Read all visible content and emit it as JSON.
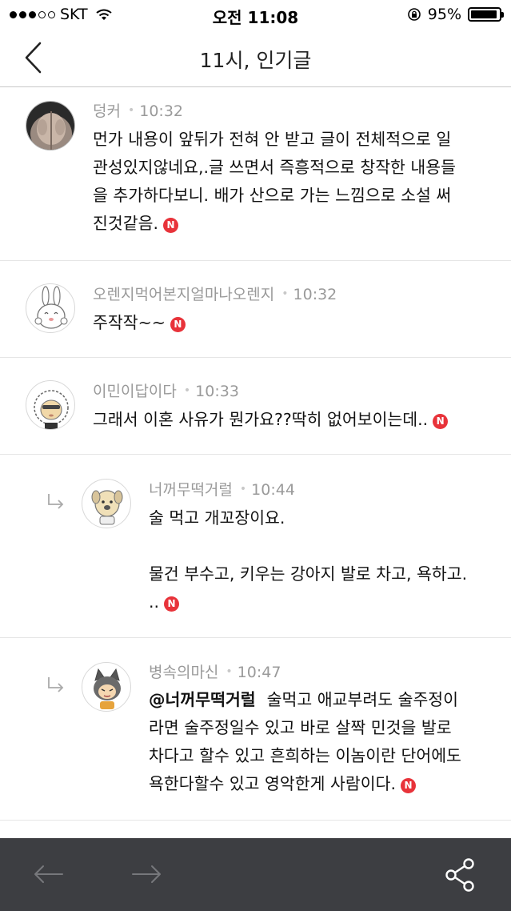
{
  "status": {
    "carrier": "SKT",
    "time": "오전 11:08",
    "battery_percent": "95%",
    "battery_level": 0.95
  },
  "nav": {
    "title": "11시, 인기글",
    "back_icon": "chevron-left-icon"
  },
  "comments": [
    {
      "author": "덩커",
      "time": "10:32",
      "text": "먼가 내용이 앞뒤가 전혀 안 받고 글이 전체적으로 일\n관성있지않네요,.글 쓰면서 즉흥적으로 창작한 내용들\n을 추가하다보니. 배가 산으로 가는 느낌으로 소설 써\n진것같음.",
      "badge": "N",
      "is_reply": false
    },
    {
      "author": "오렌지먹어본지얼마나오렌지",
      "time": "10:32",
      "text": "주작작~~",
      "badge": "N",
      "is_reply": false
    },
    {
      "author": "이민이답이다",
      "time": "10:33",
      "text": "그래서 이혼 사유가 뭔가요??딱히 없어보이는데..",
      "badge": "N",
      "is_reply": false
    },
    {
      "author": "너꺼무떡거럴",
      "time": "10:44",
      "text": "술 먹고 개꼬장이요.\n\n물건 부수고, 키우는 강아지 발로 차고, 욕하고.\n..",
      "badge": "N",
      "is_reply": true
    },
    {
      "author": "병속의마신",
      "time": "10:47",
      "mention": "@너꺼무떡거럴",
      "text": "술먹고 애교부려도 술주정이\n라면 술주정일수 있고 바로 살짝 민것을 발로\n차다고 할수 있고 흔희하는 이놈이란 단어에도\n욕한다할수 있고 영악한게 사람이다.",
      "badge": "N",
      "is_reply": true
    }
  ],
  "toolbar": {
    "back_icon": "arrow-left-icon",
    "forward_icon": "arrow-right-icon",
    "share_icon": "share-icon"
  },
  "colors": {
    "badge": "#e8333a",
    "toolbar_bg": "#3d3e42",
    "meta_text": "#9a9a9a"
  }
}
